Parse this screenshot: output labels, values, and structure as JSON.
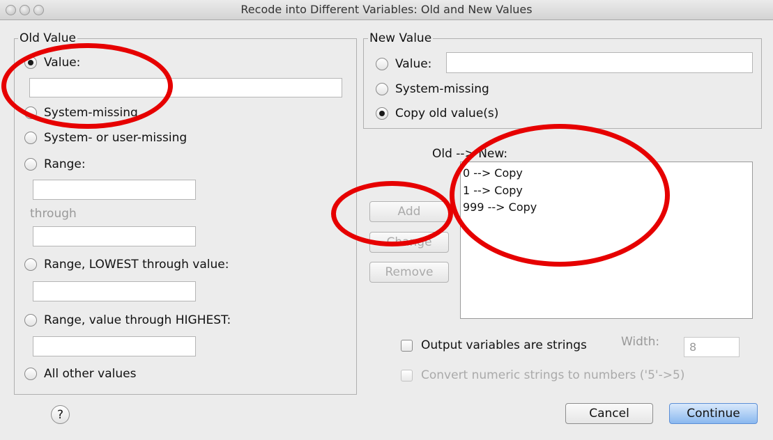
{
  "window": {
    "title": "Recode into Different Variables: Old and New Values"
  },
  "old_value": {
    "legend": "Old Value",
    "value_label": "Value:",
    "value_input": "",
    "system_missing": "System-missing",
    "system_or_user_missing": "System- or user-missing",
    "range_label": "Range:",
    "range_from": "",
    "through": "through",
    "range_to": "",
    "range_lowest": "Range, LOWEST through value:",
    "range_lowest_value": "",
    "range_highest": "Range, value through HIGHEST:",
    "range_highest_value": "",
    "all_other": "All other values"
  },
  "new_value": {
    "legend": "New Value",
    "value_label": "Value:",
    "value_input": "",
    "system_missing": "System-missing",
    "copy_old": "Copy old value(s)"
  },
  "mapping": {
    "label": "Old --> New:",
    "items": [
      "0 --> Copy",
      "1 --> Copy",
      "999 --> Copy"
    ]
  },
  "buttons": {
    "add": "Add",
    "change": "Change",
    "remove": "Remove",
    "cancel": "Cancel",
    "continue": "Continue",
    "help": "?"
  },
  "options": {
    "output_strings": "Output variables are strings",
    "width_label": "Width:",
    "width_value": "8",
    "convert_numeric": "Convert numeric strings to numbers ('5'->5)"
  },
  "colors": {
    "annotation": "#e60000",
    "primary_button": "#8ab8ef"
  }
}
